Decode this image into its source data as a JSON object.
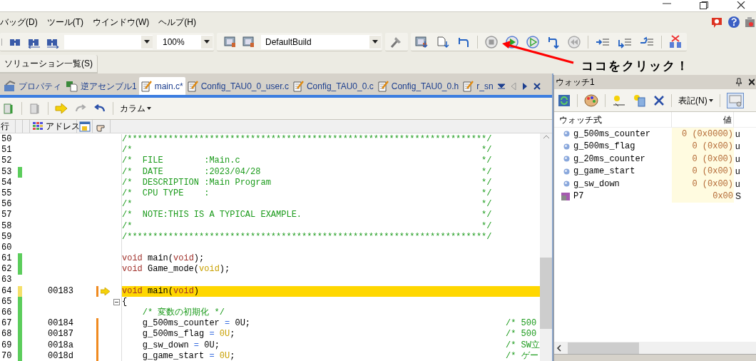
{
  "menu": [
    {
      "label": "バッグ(D)"
    },
    {
      "label": "ツール(T)"
    },
    {
      "label": "ウインドウ(W)"
    },
    {
      "label": "ヘルプ(H)"
    }
  ],
  "toolbar": {
    "zoom": "100%",
    "build_config": "DefaultBuild"
  },
  "solution_tab": {
    "label": "ソリューション一覧(S)"
  },
  "doc_tabs": [
    {
      "label": "プロパティ",
      "kind": "property",
      "selected": false
    },
    {
      "label": "逆アセンブル1",
      "kind": "disasm",
      "selected": false
    },
    {
      "label": "main.c*",
      "kind": "file",
      "selected": true
    },
    {
      "label": "Config_TAU0_0_user.c",
      "kind": "file",
      "selected": false
    },
    {
      "label": "Config_TAU0_0.c",
      "kind": "file",
      "selected": false
    },
    {
      "label": "Config_TAU0_0.h",
      "kind": "file",
      "selected": false
    },
    {
      "label": "r_sn",
      "kind": "file",
      "selected": false
    }
  ],
  "editor": {
    "column_menu": "カラム",
    "columns": [
      "行",
      "アドレス"
    ],
    "lines": [
      {
        "number": "50",
        "changed": false,
        "tokens": [
          {
            "kind": "comment",
            "text": "/**********************************************************************/"
          }
        ]
      },
      {
        "number": "51",
        "changed": false,
        "tokens": [
          {
            "kind": "comment",
            "text": "/*"
          }
        ],
        "trailing": {
          "kind": "edge",
          "text": "*/"
        }
      },
      {
        "number": "52",
        "changed": false,
        "tokens": [
          {
            "kind": "comment",
            "text": "/*  FILE        :Main.c"
          }
        ],
        "trailing": {
          "kind": "edge",
          "text": "*/"
        }
      },
      {
        "number": "53",
        "changed": true,
        "tokens": [
          {
            "kind": "comment",
            "text": "/*  DATE        :2023/04/28"
          }
        ],
        "trailing": {
          "kind": "edge",
          "text": "*/"
        }
      },
      {
        "number": "54",
        "changed": false,
        "tokens": [
          {
            "kind": "comment",
            "text": "/*  DESCRIPTION :Main Program"
          }
        ],
        "trailing": {
          "kind": "edge",
          "text": "*/"
        }
      },
      {
        "number": "55",
        "changed": false,
        "tokens": [
          {
            "kind": "comment",
            "text": "/*  CPU TYPE    :"
          }
        ],
        "trailing": {
          "kind": "edge",
          "text": "*/"
        }
      },
      {
        "number": "56",
        "changed": false,
        "tokens": [
          {
            "kind": "comment",
            "text": "/*"
          }
        ],
        "trailing": {
          "kind": "edge",
          "text": "*/"
        }
      },
      {
        "number": "57",
        "changed": false,
        "tokens": [
          {
            "kind": "comment",
            "text": "/*  NOTE:THIS IS A TYPICAL EXAMPLE."
          }
        ],
        "trailing": {
          "kind": "edge",
          "text": "*/"
        }
      },
      {
        "number": "58",
        "changed": false,
        "tokens": [
          {
            "kind": "comment",
            "text": "/*"
          }
        ],
        "trailing": {
          "kind": "edge",
          "text": "*/"
        }
      },
      {
        "number": "59",
        "changed": false,
        "tokens": [
          {
            "kind": "comment",
            "text": "/**********************************************************************/"
          }
        ]
      },
      {
        "number": "60",
        "changed": false
      },
      {
        "number": "61",
        "changed": true,
        "tokens": [
          {
            "kind": "keyword",
            "text": "void"
          },
          {
            "kind": "plain",
            "text": " main("
          },
          {
            "kind": "keyword",
            "text": "void"
          },
          {
            "kind": "plain",
            "text": ");"
          }
        ]
      },
      {
        "number": "62",
        "changed": true,
        "tokens": [
          {
            "kind": "keyword",
            "text": "void"
          },
          {
            "kind": "plain",
            "text": " Game_mode("
          },
          {
            "kind": "number",
            "text": "void"
          },
          {
            "kind": "plain",
            "text": ");"
          }
        ]
      },
      {
        "number": "63",
        "changed": false
      },
      {
        "number": "64",
        "changed": false,
        "address": "00183",
        "code_bar": true,
        "current": true,
        "tokens": [
          {
            "kind": "keyword",
            "text": "void"
          },
          {
            "kind": "plain",
            "text": " main("
          },
          {
            "kind": "keyword",
            "text": "void"
          },
          {
            "kind": "plain",
            "text": ")"
          }
        ]
      },
      {
        "number": "65",
        "changed": true,
        "fold": true,
        "tokens": [
          {
            "kind": "plain",
            "text": "{"
          }
        ]
      },
      {
        "number": "66",
        "changed": true,
        "tokens": [
          {
            "kind": "comment",
            "text": "    /* 変数の初期化 */"
          }
        ]
      },
      {
        "number": "67",
        "changed": true,
        "address": "00184",
        "code_bar": true,
        "tokens": [
          {
            "kind": "plain",
            "text": "    g_500ms_counter "
          },
          {
            "kind": "operator",
            "text": "="
          },
          {
            "kind": "plain",
            "text": " 0U;"
          }
        ],
        "trailing": {
          "kind": "note",
          "text": "/* 500"
        }
      },
      {
        "number": "68",
        "changed": true,
        "address": "00187",
        "code_bar": true,
        "tokens": [
          {
            "kind": "plain",
            "text": "    g_500ms_flag "
          },
          {
            "kind": "operator",
            "text": "="
          },
          {
            "kind": "number",
            "text": " 0U"
          },
          {
            "kind": "plain",
            "text": ";"
          }
        ],
        "trailing": {
          "kind": "note",
          "text": "/* 500"
        }
      },
      {
        "number": "69",
        "changed": true,
        "address": "0018a",
        "code_bar": true,
        "tokens": [
          {
            "kind": "plain",
            "text": "    g_sw_down "
          },
          {
            "kind": "operator",
            "text": "="
          },
          {
            "kind": "plain",
            "text": " 0U;"
          }
        ],
        "trailing": {
          "kind": "note",
          "text": "/* SW立"
        }
      },
      {
        "number": "70",
        "changed": true,
        "address": "0018d",
        "code_bar": true,
        "tokens": [
          {
            "kind": "plain",
            "text": "    g_game_start "
          },
          {
            "kind": "operator",
            "text": "="
          },
          {
            "kind": "number",
            "text": " 0U"
          },
          {
            "kind": "plain",
            "text": ";"
          }
        ],
        "trailing": {
          "kind": "note",
          "text": "/* ゲー"
        }
      }
    ]
  },
  "watch": {
    "title": "ウォッチ1",
    "notation_menu": "表記(N)",
    "columns": [
      "ウォッチ式",
      "値"
    ],
    "rows": [
      {
        "kind": "variable",
        "name": "g_500ms_counter",
        "value": "0 (0x0000)",
        "type": "u"
      },
      {
        "kind": "variable",
        "name": "g_500ms_flag",
        "value": "0 (0x00)",
        "type": "u"
      },
      {
        "kind": "variable",
        "name": "g_20ms_counter",
        "value": "0 (0x00)",
        "type": "u"
      },
      {
        "kind": "variable",
        "name": "g_game_start",
        "value": "0 (0x00)",
        "type": "u"
      },
      {
        "kind": "variable",
        "name": "g_sw_down",
        "value": "0 (0x00)",
        "type": "u"
      },
      {
        "kind": "register",
        "name": "P7",
        "value": "0x00",
        "type": "S"
      }
    ]
  },
  "annotation": {
    "text": "ココをクリック！"
  }
}
